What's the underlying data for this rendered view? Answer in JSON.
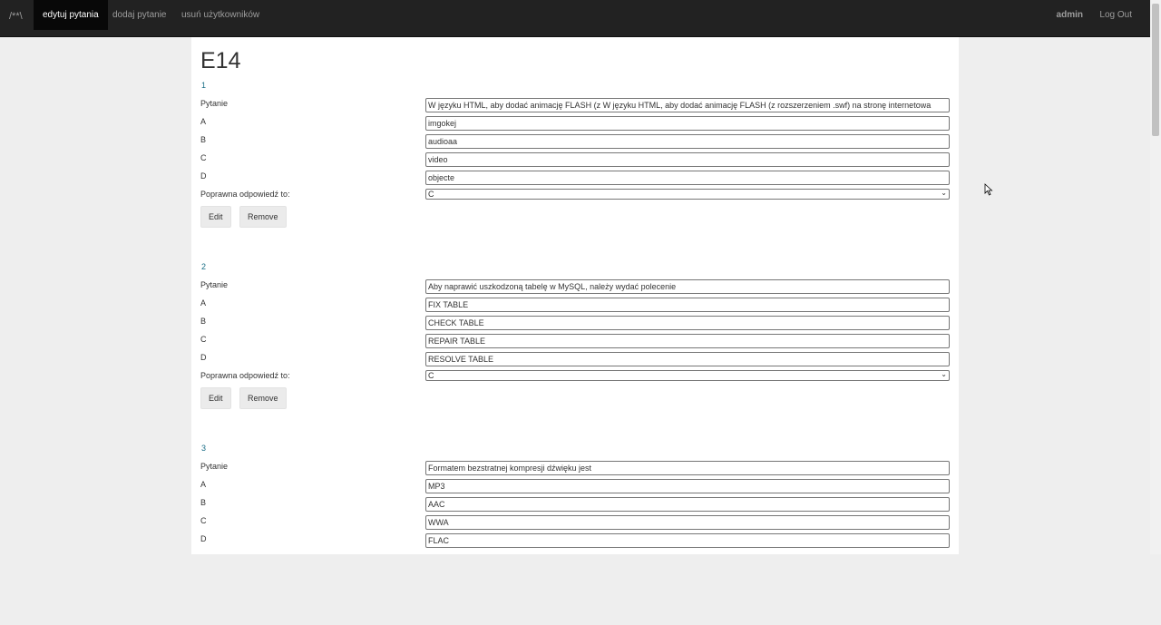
{
  "nav": {
    "brand": "/**\\",
    "items": [
      {
        "label": "edytuj pytania"
      },
      {
        "label": "dodaj pytanie"
      },
      {
        "label": "usuń użytkowników"
      }
    ],
    "user": "admin",
    "logout": "Log Out"
  },
  "page": {
    "title": "E14"
  },
  "labels": {
    "question": "Pytanie",
    "a": "A",
    "b": "B",
    "c": "C",
    "d": "D",
    "correct": "Poprawna odpowiedź to:",
    "edit": "Edit",
    "remove": "Remove"
  },
  "questions": [
    {
      "num": "1",
      "question": "W języku HTML, aby dodać animację FLASH (z W języku HTML, aby dodać animację FLASH (z rozszerzeniem .swf) na stronę internetowa",
      "a": "imgokej",
      "b": "audioaa",
      "c": "video",
      "d": "objecte",
      "correct": "C"
    },
    {
      "num": "2",
      "question": "Aby naprawić uszkodzoną tabelę w MySQL, należy wydać polecenie",
      "a": "FIX TABLE",
      "b": "CHECK TABLE",
      "c": "REPAIR TABLE",
      "d": "RESOLVE TABLE",
      "correct": "C"
    },
    {
      "num": "3",
      "question": "Formatem bezstratnej kompresji dźwięku jest",
      "a": "MP3",
      "b": "AAC",
      "c": "WWA",
      "d": "FLAC",
      "correct": ""
    }
  ]
}
